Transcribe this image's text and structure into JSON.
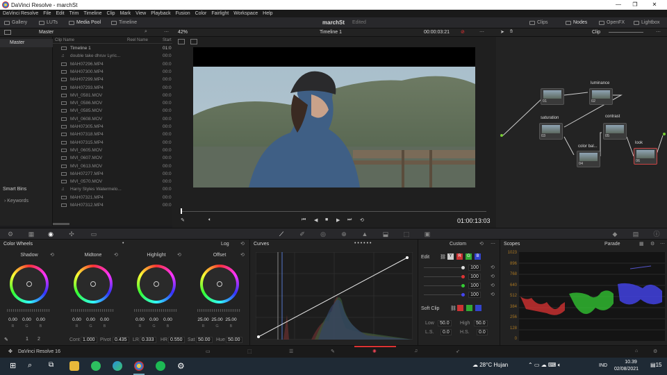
{
  "window": {
    "title": "DaVinci Resolve - marchSt",
    "minimize": "—",
    "maximize": "❐",
    "close": "✕"
  },
  "menu": [
    "DaVinci Resolve",
    "File",
    "Edit",
    "Trim",
    "Timeline",
    "Clip",
    "Mark",
    "View",
    "Playback",
    "Fusion",
    "Color",
    "Fairlight",
    "Workspace",
    "Help"
  ],
  "toolbar": {
    "gallery": "Gallery",
    "luts": "LUTs",
    "media_pool": "Media Pool",
    "timeline": "Timeline",
    "project": "marchSt",
    "status": "Edited",
    "clips": "Clips",
    "nodes": "Nodes",
    "openfx": "OpenFX",
    "lightbox": "Lightbox"
  },
  "pool": {
    "bin": "Master",
    "master": "Master",
    "smart_bins": "Smart Bins",
    "keywords": "Keywords"
  },
  "clip_columns": {
    "name": "Clip Name",
    "reel": "Reel Name",
    "start": "Start"
  },
  "clips": [
    {
      "name": "Timeline 1",
      "start": "01:0"
    },
    {
      "name": "double take  dhruv Lyric...",
      "start": "00:0"
    },
    {
      "name": "MAH07296.MP4",
      "start": "00:0"
    },
    {
      "name": "MAH07300.MP4",
      "start": "00:0"
    },
    {
      "name": "MAH07299.MP4",
      "start": "00:0"
    },
    {
      "name": "MAH07293.MP4",
      "start": "00:0"
    },
    {
      "name": "MVI_0581.MOV",
      "start": "00:0"
    },
    {
      "name": "MVI_0586.MOV",
      "start": "00:0"
    },
    {
      "name": "MVI_0585.MOV",
      "start": "00:0"
    },
    {
      "name": "MVI_0608.MOV",
      "start": "00:0"
    },
    {
      "name": "MAH07305.MP4",
      "start": "00:0"
    },
    {
      "name": "MAH07318.MP4",
      "start": "00:0"
    },
    {
      "name": "MAH07315.MP4",
      "start": "00:0"
    },
    {
      "name": "MVI_0605.MOV",
      "start": "00:0"
    },
    {
      "name": "MVI_0607.MOV",
      "start": "00:0"
    },
    {
      "name": "MVI_0613.MOV",
      "start": "00:0"
    },
    {
      "name": "MAH07277.MP4",
      "start": "00:0"
    },
    {
      "name": "MVI_0570.MOV",
      "start": "00:0"
    },
    {
      "name": "Harry Styles  Watermelo...",
      "start": "00:0"
    },
    {
      "name": "MAH07321.MP4",
      "start": "00:0"
    },
    {
      "name": "MAH07312.MP4",
      "start": "00:0"
    }
  ],
  "viewer": {
    "zoom": "42%",
    "timeline": "Timeline 1",
    "timecode_top": "00:00:03:21",
    "timecode": "01:00:13:03",
    "clip_mode": "Clip"
  },
  "nodes": [
    {
      "id": "01",
      "label": ""
    },
    {
      "id": "02",
      "label": "luminance"
    },
    {
      "id": "03",
      "label": "saturation"
    },
    {
      "id": "04",
      "label": "color bal..."
    },
    {
      "id": "05",
      "label": "contrast"
    },
    {
      "id": "06",
      "label": "look"
    }
  ],
  "color_wheels": {
    "title": "Color Wheels",
    "mode": "Log",
    "wheels": [
      {
        "name": "Shadow",
        "values": [
          "0.00",
          "0.00",
          "0.00"
        ]
      },
      {
        "name": "Midtone",
        "values": [
          "0.00",
          "0.00",
          "0.00"
        ]
      },
      {
        "name": "Highlight",
        "values": [
          "0.00",
          "0.00",
          "0.00"
        ]
      },
      {
        "name": "Offset",
        "values": [
          "25.00",
          "25.00",
          "25.00"
        ]
      }
    ],
    "rgb": [
      "R",
      "G",
      "B"
    ],
    "page1": "1",
    "page2": "2",
    "params": {
      "cont_label": "Cont",
      "cont": "1.000",
      "pivot_label": "Pivot",
      "pivot": "0.435",
      "lr_label": "LR",
      "lr": "0.333",
      "hr_label": "HR",
      "hr": "0.550",
      "sat_label": "Sat",
      "sat": "50.00",
      "hue_label": "Hue",
      "hue": "50.00"
    }
  },
  "curves": {
    "title": "Curves",
    "mode": "Custom"
  },
  "edit_panel": {
    "edit": "Edit",
    "y": "Y",
    "r": "R",
    "g": "G",
    "b": "B",
    "values": [
      "100",
      "100",
      "100",
      "100"
    ],
    "soft_clip": "Soft Clip",
    "low_label": "Low",
    "low": "50.0",
    "high_label": "High",
    "high": "50.0",
    "ls_label": "L.S.",
    "ls": "0.0",
    "hs_label": "H.S.",
    "hs": "0.0"
  },
  "scopes": {
    "title": "Scopes",
    "mode": "Parade",
    "ticks": [
      "1023",
      "896",
      "768",
      "640",
      "512",
      "384",
      "256",
      "128",
      "0"
    ]
  },
  "pages_bar": {
    "app": "DaVinci Resolve 16"
  },
  "taskbar": {
    "weather": "28°C  Hujan",
    "lang": "IND",
    "time": "10.39",
    "date": "02/08/2021",
    "notif": "15"
  }
}
